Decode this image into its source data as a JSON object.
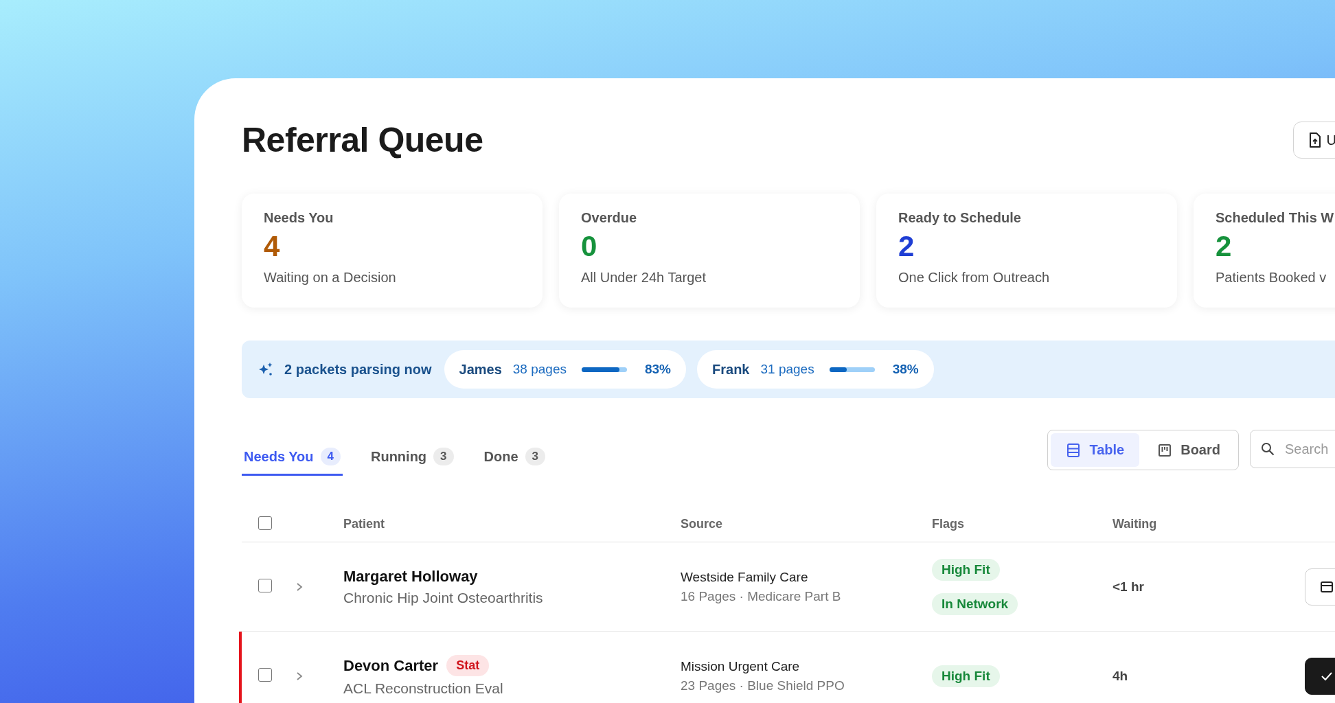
{
  "header": {
    "title": "Referral Queue",
    "upload_button": {
      "label": "U"
    }
  },
  "stats": [
    {
      "label": "Needs You",
      "value": "4",
      "caption": "Waiting on a Decision",
      "color": "#b05a06"
    },
    {
      "label": "Overdue",
      "value": "0",
      "caption": "All Under 24h Target",
      "color": "#16923c"
    },
    {
      "label": "Ready to Schedule",
      "value": "2",
      "caption": "One Click from Outreach",
      "color": "#1f3ed4"
    },
    {
      "label": "Scheduled This W",
      "value": "2",
      "caption": "Patients Booked v",
      "color": "#16923c"
    }
  ],
  "parsing": {
    "summary": "2 packets parsing now",
    "packets": [
      {
        "name": "James",
        "pages": "38 pages",
        "level": 0.83,
        "percent": "83%"
      },
      {
        "name": "Frank",
        "pages": "31 pages",
        "level": 0.38,
        "percent": "38%"
      }
    ]
  },
  "tabs": [
    {
      "label": "Needs You",
      "count": "4",
      "selected": true
    },
    {
      "label": "Running",
      "count": "3",
      "selected": false
    },
    {
      "label": "Done",
      "count": "3",
      "selected": false
    }
  ],
  "views": [
    {
      "label": "Table",
      "kind": "table",
      "selected": true
    },
    {
      "label": "Board",
      "kind": "board",
      "selected": false
    }
  ],
  "search": {
    "placeholder": "Search"
  },
  "table": {
    "select_all": {
      "checked": false
    },
    "columns": [
      "Patient",
      "Source",
      "Flags",
      "Waiting"
    ],
    "rows": [
      {
        "checked": false,
        "expanded": false,
        "urgent": false,
        "name": "Margaret Holloway",
        "condition": "Chronic Hip Joint Osteoarthritis",
        "source": "Westside Family Care",
        "source_detail": "16 Pages ·  Medicare Part B",
        "flags": [
          "High Fit",
          "In Network"
        ],
        "waiting": "<1 hr",
        "action": {
          "kind": "outline"
        }
      },
      {
        "checked": false,
        "expanded": false,
        "urgent": true,
        "badge": "Stat",
        "name": "Devon Carter",
        "condition": "ACL Reconstruction Eval",
        "source": "Mission Urgent Care",
        "source_detail": "23 Pages · Blue Shield PPO",
        "flags": [
          "High Fit"
        ],
        "waiting": "4h",
        "action": {
          "kind": "dark"
        }
      }
    ]
  }
}
